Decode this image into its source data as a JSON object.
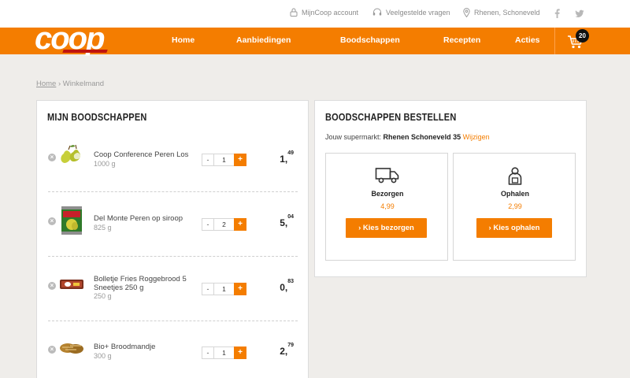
{
  "utility": {
    "account": "MijnCoop account",
    "faq": "Veelgestelde vragen",
    "location": "Rhenen, Schoneveld"
  },
  "brand": {
    "logo_text": "coop",
    "accent": "#f47d00",
    "logo_stripe": "#c0140f"
  },
  "nav": {
    "items": [
      "Home",
      "Aanbiedingen",
      "Boodschappen",
      "Recepten",
      "Acties"
    ],
    "cart_count": "20"
  },
  "breadcrumb": {
    "home": "Home",
    "separator": "›",
    "current": "Winkelmand"
  },
  "cart": {
    "title": "MIJN BOODSCHAPPEN",
    "items": [
      {
        "name": "Coop Conference Peren Los",
        "weight": "1000 g",
        "qty": "1",
        "price_euro": "1,",
        "price_cents": "49"
      },
      {
        "name": "Del Monte Peren op siroop",
        "weight": "825 g",
        "qty": "2",
        "price_euro": "5,",
        "price_cents": "04"
      },
      {
        "name": "Bolletje Fries Roggebrood 5 Sneetjes 250 g",
        "weight": "250 g",
        "qty": "1",
        "price_euro": "0,",
        "price_cents": "83"
      },
      {
        "name": "Bio+ Broodmandje",
        "weight": "300 g",
        "qty": "1",
        "price_euro": "2,",
        "price_cents": "79"
      }
    ],
    "minus": "-",
    "plus": "+",
    "remove": "×"
  },
  "order": {
    "title": "BOODSCHAPPEN BESTELLEN",
    "store_prefix": "Jouw supermarkt:",
    "store_name": "Rhenen Schoneveld 35",
    "store_change": "Wijzigen",
    "delivery": {
      "label": "Bezorgen",
      "price": "4,99",
      "button": "› Kies bezorgen",
      "icon": "truck-icon"
    },
    "pickup": {
      "label": "Ophalen",
      "price": "2,99",
      "button": "› Kies ophalen",
      "icon": "pickup-person-icon"
    }
  }
}
